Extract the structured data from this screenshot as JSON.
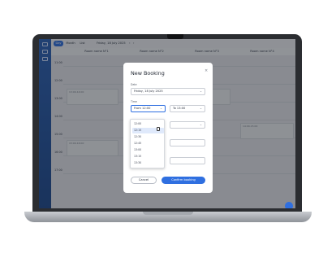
{
  "toolbar": {
    "views": [
      "Day",
      "Month",
      "List"
    ],
    "active_view": "Day",
    "date": "Friday, 18 July 2025",
    "prev": "‹",
    "next": "›"
  },
  "rooms": [
    "Room name N°1",
    "Room name N°2",
    "Room name N°3",
    "Room name N°4"
  ],
  "times": [
    "11:00",
    "12:00",
    "13:00",
    "14:00",
    "15:00",
    "16:00",
    "17:00"
  ],
  "bookings": [
    {
      "label": "13:00-14:00"
    },
    {
      "label": "13:00-14:00"
    },
    {
      "label": "14:00-15:00"
    },
    {
      "label": "15:00-16:00"
    }
  ],
  "modal": {
    "title": "New Booking",
    "close_icon": "close-icon",
    "date_label": "Date",
    "date_value": "Friday, 18 July 2025",
    "time_label": "Time",
    "from_value": "From 12:00",
    "to_value": "To 13:00",
    "cancel_label": "Cancel",
    "confirm_label": "Confirm booking"
  },
  "dropdown": {
    "options": [
      "12:00",
      "12:15",
      "12:30",
      "12:45",
      "13:00",
      "13:15",
      "13:30"
    ],
    "selected": "12:15"
  },
  "colors": {
    "accent": "#2f6fe0",
    "sidebar": "#1f4a8f"
  }
}
